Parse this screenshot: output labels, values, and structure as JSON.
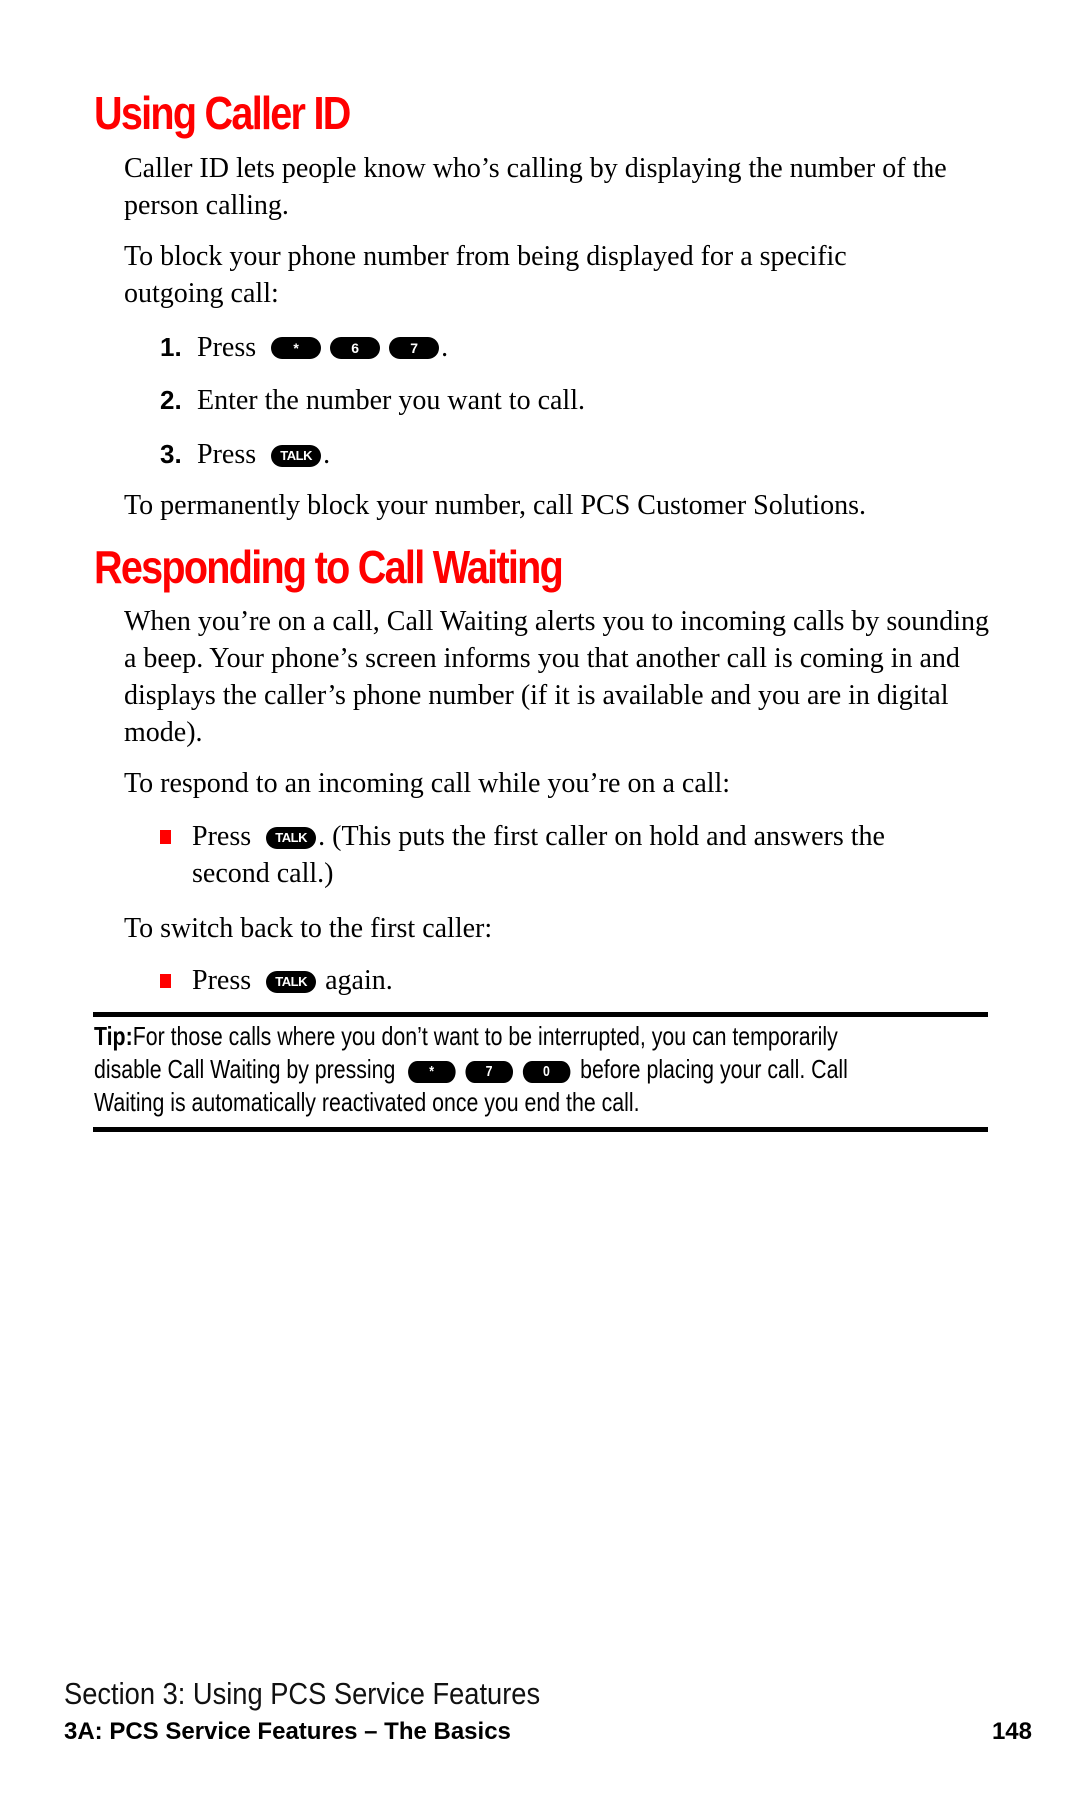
{
  "section1": {
    "title": "Using Caller ID",
    "intro": "Caller ID lets people know who’s calling by displaying the number of the person calling.",
    "block_intro": "To block your phone number from being displayed for a specific outgoing call:",
    "steps": [
      {
        "num": "1.",
        "text": "Press",
        "keys": [
          "*",
          "6",
          "7"
        ],
        "suffix": "."
      },
      {
        "num": "2.",
        "text": "Enter the number you want to call."
      },
      {
        "num": "3.",
        "text": "Press",
        "keys": [
          "TALK"
        ],
        "suffix": "."
      }
    ],
    "permanent": "To permanently block your number, call PCS Customer Solutions."
  },
  "section2": {
    "title": "Responding to Call Waiting",
    "intro": "When you’re on a call, Call Waiting alerts you to incoming calls by sounding a beep. Your phone’s screen informs you that another call is coming in and displays the caller’s phone number (if it is available and you are in digital mode).",
    "respond_intro": "To respond to an incoming call while you’re on a call:",
    "bullet1": {
      "text": "Press",
      "key": "TALK",
      "rest": ". (This puts the first caller on hold and answers the",
      "rest2": "second call.)"
    },
    "switch_intro": "To switch back to the first caller:",
    "bullet2": {
      "text": "Press",
      "key": "TALK",
      "rest": "again."
    }
  },
  "tip": {
    "label": "Tip:",
    "line1": "For those calls where you don’t want to be interrupted, you can temporarily",
    "line2_pre": "disable Call Waiting by pressing",
    "keys": [
      "*",
      "7",
      "0"
    ],
    "line2_post": "before placing your call. Call",
    "line3": "Waiting is automatically reactivated once you end the call."
  },
  "footer": {
    "section": "Section 3: Using PCS Service Features",
    "chapter": "3A: PCS Service Features – The Basics",
    "page": "148"
  },
  "colors": {
    "heading": "#ff0000",
    "bullet": "#ff0000",
    "key_bg": "#000000"
  }
}
